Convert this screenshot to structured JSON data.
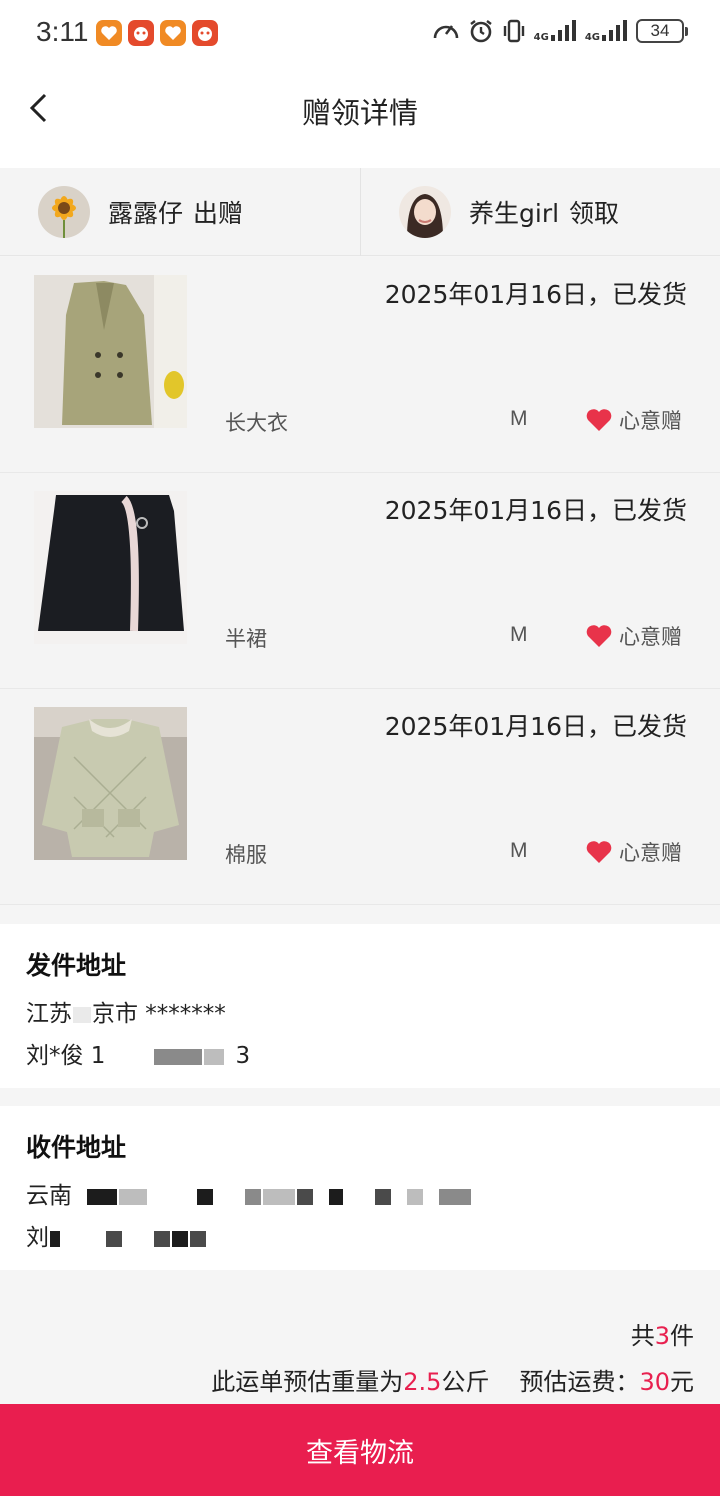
{
  "status_bar": {
    "time": "3:11",
    "net1": "4G",
    "net2": "4G",
    "battery": "34"
  },
  "header": {
    "title": "赠领详情"
  },
  "users": {
    "giver": {
      "name": "露露仔",
      "role": "出赠"
    },
    "receiver": {
      "name": "养生girl",
      "role": "领取"
    }
  },
  "items": [
    {
      "date_status": "2025年01月16日，已发货",
      "name": "长大衣",
      "size": "M",
      "tag": "心意赠",
      "thumb": "coat-photo"
    },
    {
      "date_status": "2025年01月16日，已发货",
      "name": "半裙",
      "size": "M",
      "tag": "心意赠",
      "thumb": "skirt-photo"
    },
    {
      "date_status": "2025年01月16日，已发货",
      "name": "棉服",
      "size": "M",
      "tag": "心意赠",
      "thumb": "padded-jacket-photo"
    }
  ],
  "sender_address": {
    "title": "发件地址",
    "line1_start": "江苏",
    "line1_mid": "京市 *******",
    "line2_start": "刘*俊 1",
    "line2_end": "3"
  },
  "receiver_address": {
    "title": "收件地址",
    "line1_start": "云南",
    "line2_start": "刘"
  },
  "summary": {
    "count_prefix": "共",
    "count": "3",
    "count_suffix": "件",
    "weight_prefix": "此运单预估重量为",
    "weight": "2.5",
    "weight_unit": "公斤",
    "fee_prefix": "预估运费：",
    "fee": "30",
    "fee_unit": "元"
  },
  "actions": {
    "view_logistics": "查看物流"
  },
  "colors": {
    "accent": "#e91e4f",
    "heart": "#e8334a"
  }
}
